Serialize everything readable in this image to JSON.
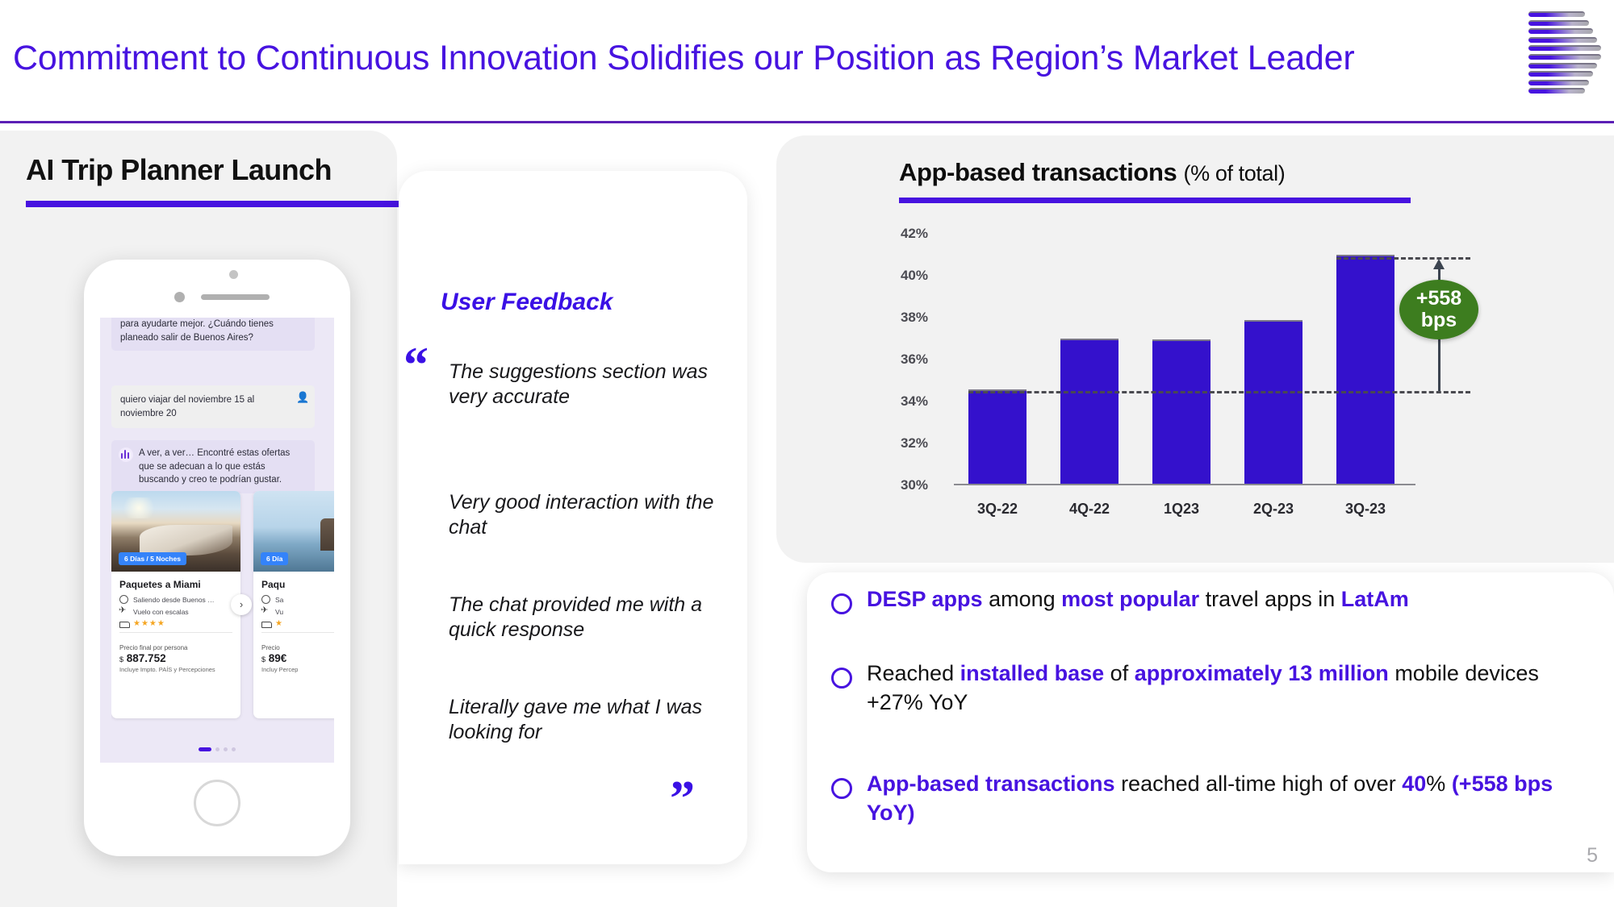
{
  "header": {
    "title": "Commitment to Continuous Innovation Solidifies our Position as Region’s Market Leader",
    "logo_name": "company-logo"
  },
  "slide_number": "5",
  "left_panel": {
    "title": "AI Trip Planner Launch",
    "phone": {
      "chat": [
        {
          "role": "bot",
          "text": "para ayudarte mejor. ¿Cuándo tienes planeado salir de Buenos Aires?"
        },
        {
          "role": "user",
          "text": "quiero viajar del noviembre 15 al noviembre 20"
        },
        {
          "role": "bot",
          "text": "A ver, a ver… Encontré estas ofertas que se adecuan a lo que estás buscando y creo te podrían gustar."
        }
      ],
      "offers": [
        {
          "badge": "6 Días / 5 Noches",
          "name": "Paquetes a Miami",
          "origin": "Saliendo desde Buenos …",
          "flight": "Vuelo con escalas",
          "stars": "★★★★",
          "price_label": "Precio final por persona",
          "currency": "$",
          "price": "887.752",
          "price_note": "Incluye Impto. PAÍS y Percepciones"
        },
        {
          "badge": "6 Día",
          "name": "Paqu",
          "origin": "Sa",
          "flight": "Vu",
          "stars": "★",
          "price_label": "Precio",
          "currency": "$",
          "price": "89€",
          "price_note": "Incluy Percep"
        }
      ],
      "carousel_arrow": "›"
    }
  },
  "feedback_panel": {
    "title": "User Feedback",
    "quote_open": "“",
    "quote_close": "”",
    "quotes": [
      "The suggestions section was very accurate",
      "Very good interaction with the chat",
      "The chat provided me with a quick response",
      "Literally gave me what I was looking for"
    ]
  },
  "chart_panel": {
    "title_main": "App-based transactions",
    "title_sub": "(% of total)"
  },
  "chart_data": {
    "type": "bar",
    "title": "App-based transactions (% of total)",
    "xlabel": "",
    "ylabel": "% of total",
    "categories": [
      "3Q-22",
      "4Q-22",
      "1Q23",
      "2Q-23",
      "3Q-23"
    ],
    "values": [
      34.5,
      36.9,
      36.85,
      37.8,
      40.9
    ],
    "ylim": [
      30,
      42
    ],
    "yticks": [
      "30%",
      "32%",
      "34%",
      "36%",
      "38%",
      "40%",
      "42%"
    ],
    "ytick_values": [
      30,
      32,
      34,
      36,
      38,
      40,
      42
    ],
    "grid": false,
    "legend": "none",
    "bar_color": "#3411cc",
    "annotations": [
      {
        "label_line1": "+558",
        "label_line2": "bps",
        "color": "#3d7d1f",
        "from_value": 34.5,
        "to_value": 40.9
      }
    ],
    "reference_lines": [
      {
        "value": 34.5,
        "style": "dashed"
      },
      {
        "value": 40.9,
        "style": "dashed"
      }
    ]
  },
  "bullets": [
    {
      "segments": [
        {
          "text": "DESP apps",
          "bold": true
        },
        {
          "text": " among ",
          "bold": false
        },
        {
          "text": "most popular",
          "bold": true
        },
        {
          "text": " travel apps in ",
          "bold": false
        },
        {
          "text": "LatAm",
          "bold": true
        }
      ]
    },
    {
      "segments": [
        {
          "text": "Reached ",
          "bold": false
        },
        {
          "text": "installed base",
          "bold": true
        },
        {
          "text": " of ",
          "bold": false
        },
        {
          "text": "approximately 13 million",
          "bold": true
        },
        {
          "text": " mobile devices +27% YoY",
          "bold": false
        }
      ]
    },
    {
      "segments": [
        {
          "text": "App-based transactions",
          "bold": true
        },
        {
          "text": " reached all-time high of over ",
          "bold": false
        },
        {
          "text": "40",
          "bold": true
        },
        {
          "text": "% ",
          "bold": false
        },
        {
          "text": "(+558 bps YoY)",
          "bold": true
        }
      ]
    }
  ],
  "colors": {
    "brand_purple": "#4713e0",
    "bar_purple": "#3411cc",
    "badge_green": "#3d7d1f",
    "card_grey": "#f2f2f2"
  }
}
